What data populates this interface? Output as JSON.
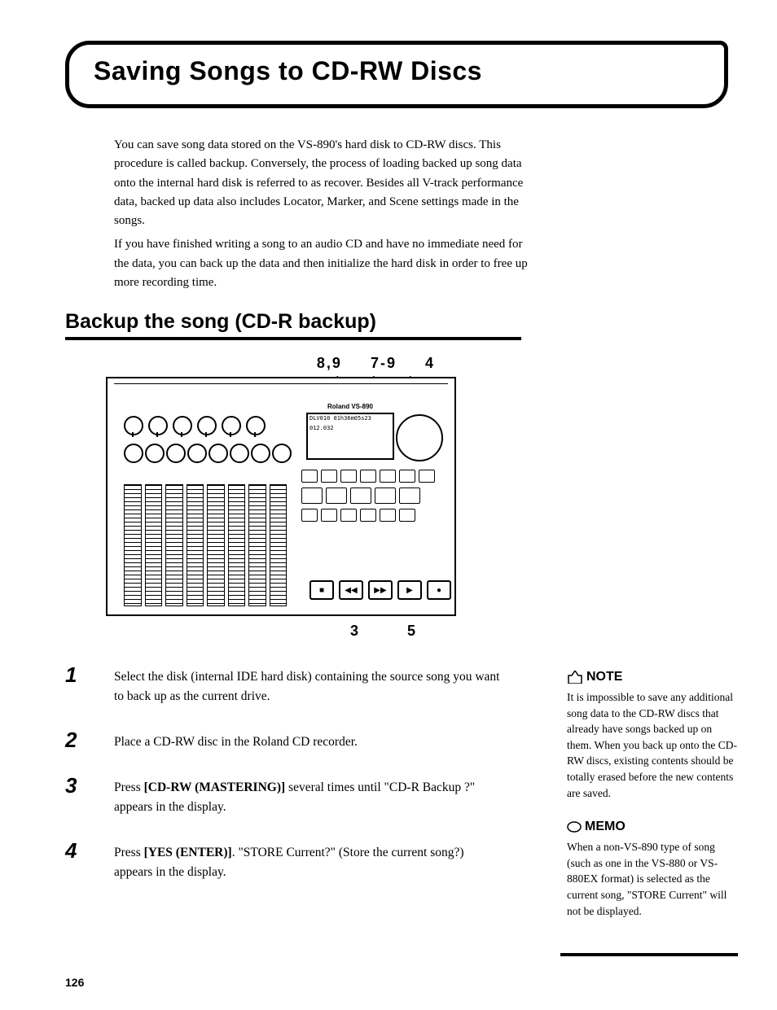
{
  "title": "Saving Songs to CD-RW Discs",
  "intro": {
    "p1": "You can save song data stored on the VS-890's hard disk to CD-RW discs. This procedure is called backup. Conversely, the process of loading backed up song data onto the internal hard disk is referred to as recover. Besides all V-track performance data, backed up data also includes Locator, Marker, and Scene settings made in the songs.",
    "p2": "If you have finished writing a song to an audio CD and have no immediate need for the data, you can back up the data and then initialize the hard disk in order to free up more recording time."
  },
  "section_heading": "Backup the song (CD-R backup)",
  "figure": {
    "callouts_top": [
      "8,9",
      "7-9",
      "4"
    ],
    "callouts_bottom": [
      "3",
      "5"
    ],
    "brand": "Roland",
    "model": "VS-890",
    "lcd_line1": "DLV010  01h36m05s23",
    "lcd_line2": "012.032"
  },
  "steps": [
    {
      "num": "1",
      "text": "Select the disk (internal IDE hard disk) containing the source song you want to back up as the current drive."
    },
    {
      "num": "2",
      "text": "Place a CD-RW disc in the Roland CD recorder."
    },
    {
      "num": "3",
      "text_pre": "Press ",
      "bold": "[CD-RW (MASTERING)]",
      "text_post": " several times until \"CD-R Backup ?\" appears in the display."
    },
    {
      "num": "4",
      "text_pre": "Press ",
      "bold": "[YES (ENTER)]",
      "text_post": ". \"STORE Current?\" (Store the current song?) appears in the display."
    }
  ],
  "sidebar": {
    "note_label": "NOTE",
    "note_text": "It is impossible to save any additional song data to the CD-RW discs that already have songs backed up on them. When you back up onto the CD-RW discs, existing contents should be totally erased before the new contents are saved.",
    "memo_label": "MEMO",
    "memo_text": "When a non-VS-890 type of song (such as one in the VS-880 or VS-880EX format) is selected as the current song, \"STORE Current\" will not be displayed."
  },
  "page_number": "126"
}
